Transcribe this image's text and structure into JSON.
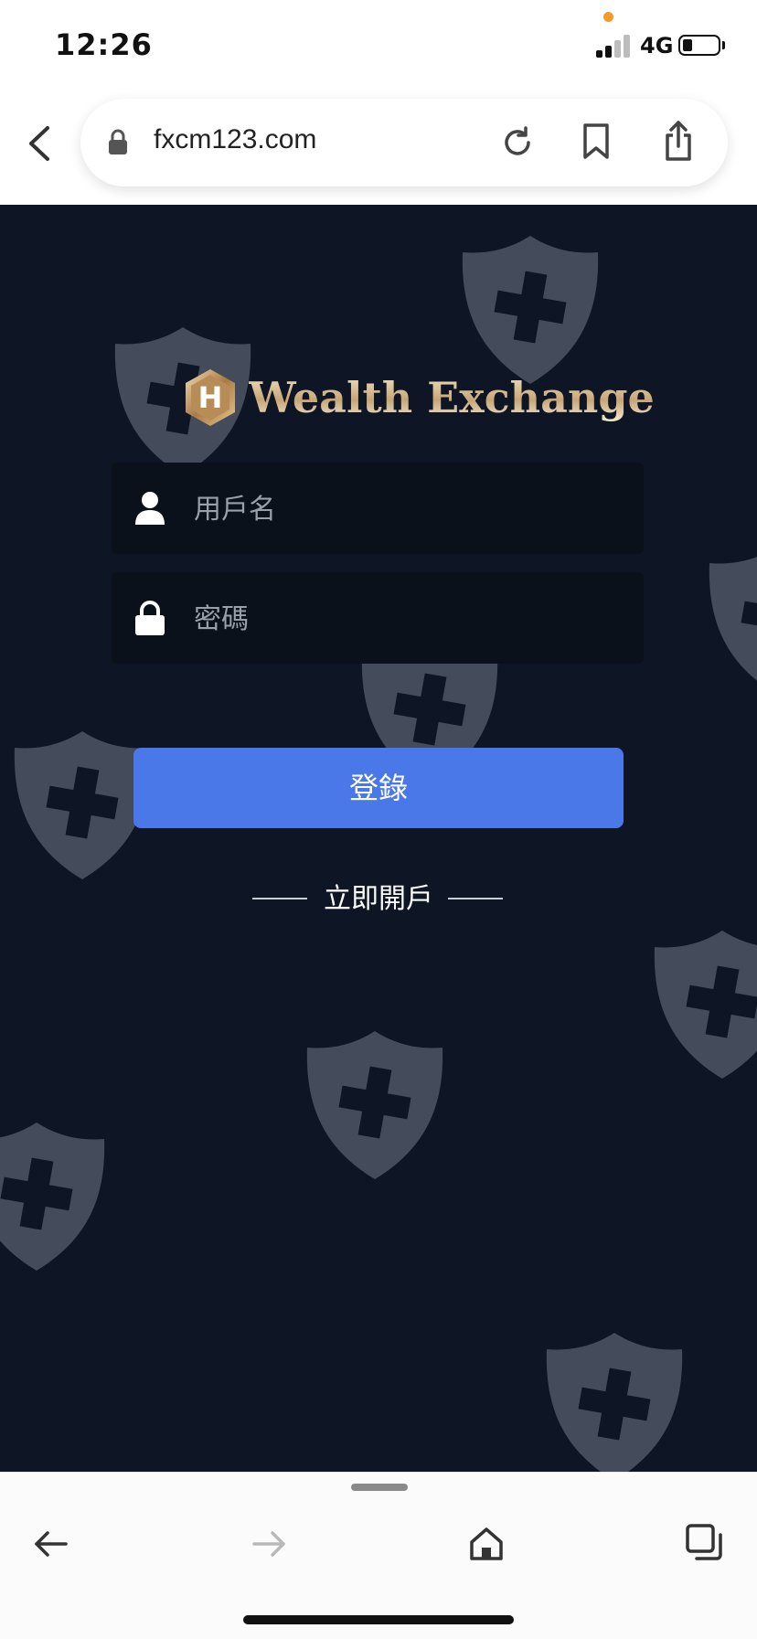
{
  "status": {
    "time": "12:26",
    "network": "4G"
  },
  "browser": {
    "url": "fxcm123.com"
  },
  "brand": {
    "name": "Wealth Exchange",
    "mark": "H"
  },
  "form": {
    "username_placeholder": "用戶名",
    "password_placeholder": "密碼",
    "login_label": "登錄",
    "register_label": "立即開戶"
  },
  "colors": {
    "background": "#0e1525",
    "field": "#0b111b",
    "primary": "#4a78e8",
    "brand_gold": "#d8c29a"
  }
}
